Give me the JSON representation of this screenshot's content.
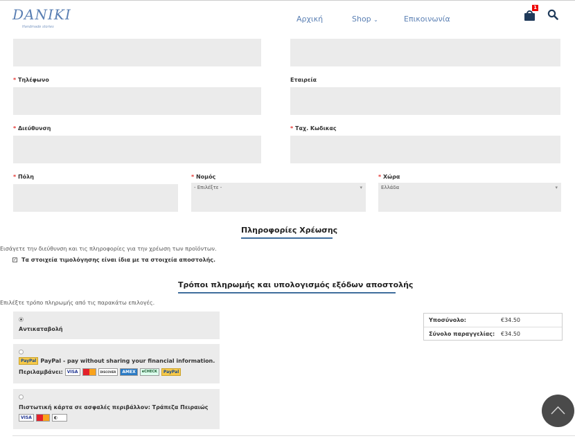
{
  "header": {
    "logo_text": "DANIKI",
    "logo_tagline": "Handmade stories",
    "nav": {
      "home": "Αρχική",
      "shop": "Shop",
      "contact": "Επικοινωνία"
    },
    "cart_count": "1"
  },
  "form": {
    "phone_label": "Τηλέφωνο",
    "company_label": "Εταιρεία",
    "address_label": "Διεύθυνση",
    "zip_label": "Ταχ. Κωδικας",
    "city_label": "Πόλη",
    "county_label": "Νομός",
    "county_value": "- Επιλέξτε -",
    "country_label": "Χώρα",
    "country_value": "Ελλάδα",
    "required_mark": "*"
  },
  "billing": {
    "title": "Πληροφορίες Χρέωσης",
    "note": "Εισάγετε την διεύθυνση και τις πληροφορίες για την χρέωση των προϊόντων.",
    "same_as_shipping": "Τα στοιχεία τιμολόγησης είναι ίδια με τα στοιχεία αποστολής.",
    "same_as_shipping_checked": true
  },
  "payment": {
    "title": "Τρόποι πληρωμής και υπολογισμός εξόδων αποστολής",
    "note": "Επιλέξτε τρόπο πληρωμής από τις παρακάτω επιλογές.",
    "cod_label": "Αντικαταβολή",
    "paypal_logo": "PayPal",
    "paypal_label": "PayPal - pay without sharing your financial information.",
    "includes_label": "Περιλαμβάνει:",
    "card_label": "Πιστωτική κάρτα σε ασφαλές περιβάλλον: Τράπεζα Πειραιώς",
    "logos": {
      "visa": "VISA",
      "discover": "DISCOVER",
      "amex": "AMEX",
      "echeck": "eCHECK",
      "paypal": "PayPal"
    }
  },
  "totals": {
    "subtotal_label": "Υποσύνολο:",
    "subtotal_value": "€34.50",
    "total_label": "Σύνολο παραγγελίας:",
    "total_value": "€34.50"
  },
  "colors": {
    "accent": "#3e6d9c",
    "field_bg": "#ebebeb",
    "required": "#e53935"
  }
}
